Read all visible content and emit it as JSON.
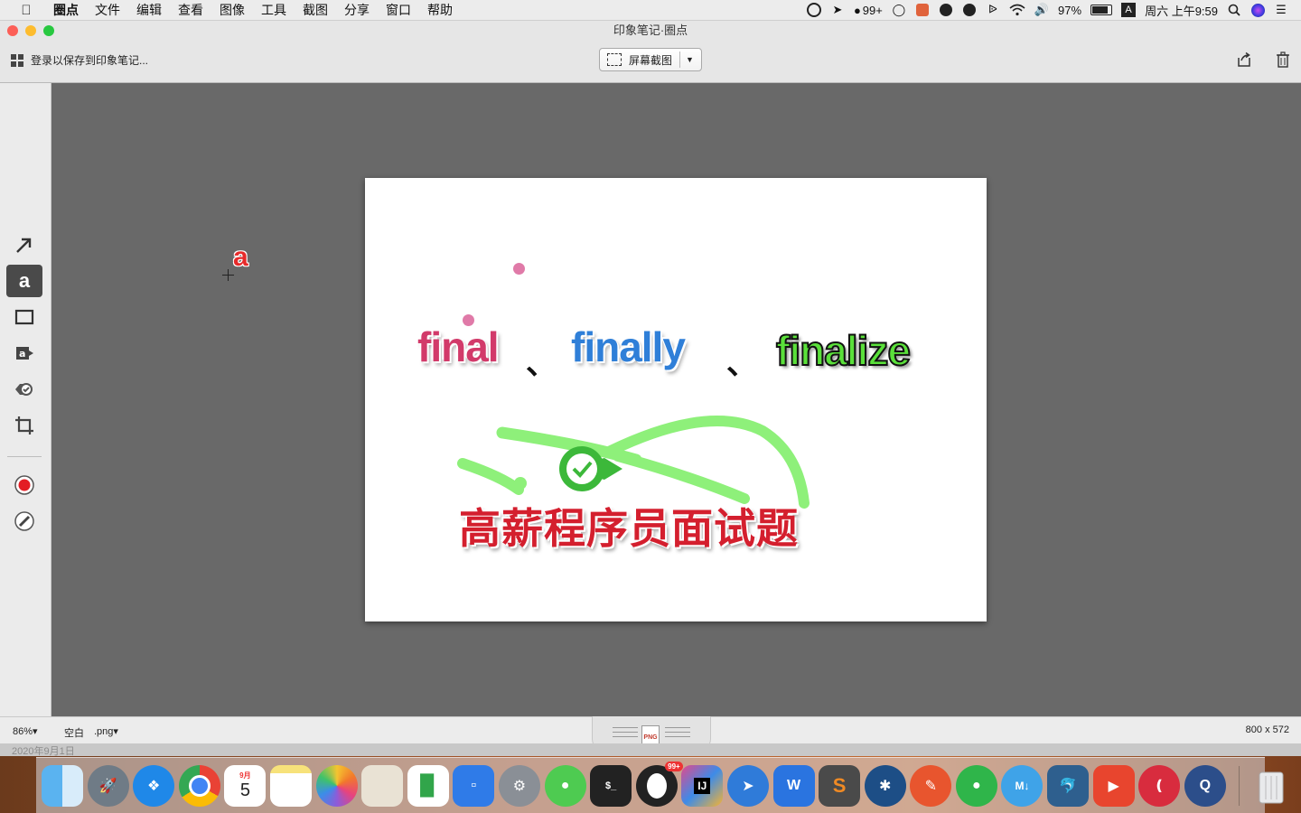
{
  "menubar": {
    "items": [
      "圈点",
      "文件",
      "编辑",
      "查看",
      "图像",
      "工具",
      "截图",
      "分享",
      "窗口",
      "帮助"
    ],
    "status": {
      "notifications": "99+",
      "battery": "97%",
      "input_source": "A",
      "clock": "周六 上午9:59"
    }
  },
  "window": {
    "title": "印象笔记·圈点",
    "login_text": "登录以保存到印象笔记...",
    "screenshot_button": "屏幕截图"
  },
  "palette": {
    "tools": [
      "arrow",
      "text",
      "rectangle",
      "stamp",
      "highlight",
      "crop"
    ],
    "active_tool": "text",
    "color_accent": "#e31d24"
  },
  "artboard": {
    "words": [
      "final",
      "finally",
      "finalize"
    ],
    "separator": "、",
    "headline": "高薪程序员面试题",
    "word_colors": [
      "#d23a6a",
      "#2f7fd8",
      "#5ae03a"
    ],
    "headline_color": "#d41f2e"
  },
  "cursor_letter": "a",
  "bottombar": {
    "zoom": "86%",
    "background": "空白",
    "format": ".png",
    "format_icon": "PNG",
    "dimensions": "800 x 572"
  },
  "date_strip": "2020年9月1日",
  "dock": {
    "calendar_month": "9月",
    "calendar_day": "5",
    "qq_badge": "99+",
    "apps": [
      "finder",
      "launchpad",
      "safari",
      "chrome",
      "calendar",
      "notes",
      "photos",
      "preview",
      "numbers",
      "keynote",
      "system-preferences",
      "wechat",
      "terminal",
      "qq",
      "intellij",
      "feishu",
      "wps",
      "sublime",
      "sourcetree",
      "pencil",
      "evernote",
      "typora",
      "mysql-workbench",
      "screen-record",
      "wps-pdf",
      "quicktime",
      "trash"
    ]
  }
}
